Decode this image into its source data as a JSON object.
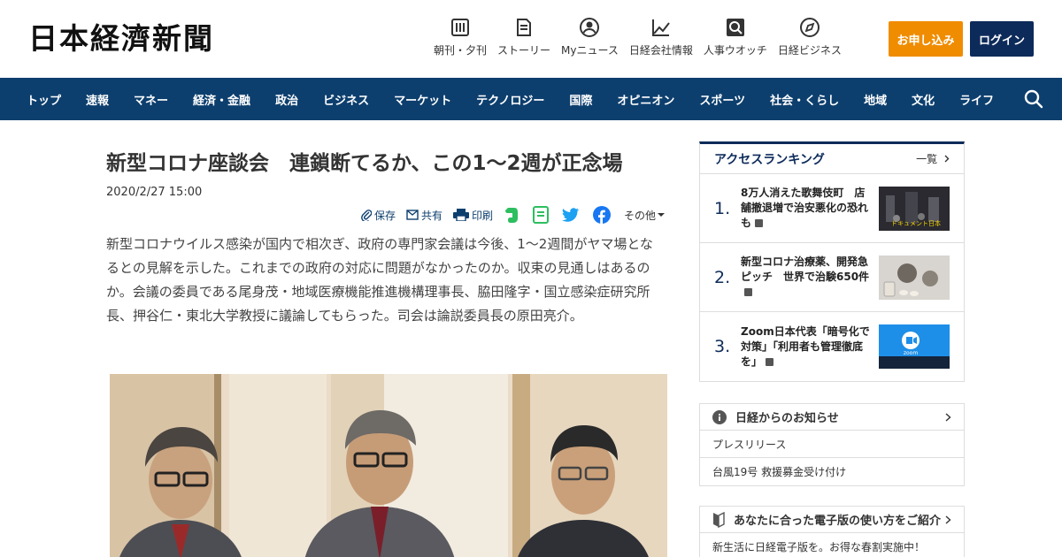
{
  "header": {
    "logo": "日本経濟新聞",
    "nav": [
      {
        "label": "朝刊・夕刊",
        "icon": "newspaper-icon"
      },
      {
        "label": "ストーリー",
        "icon": "document-icon"
      },
      {
        "label": "Myニュース",
        "icon": "user-icon"
      },
      {
        "label": "日経会社情報",
        "icon": "chart-icon"
      },
      {
        "label": "人事ウオッチ",
        "icon": "search-person-icon"
      },
      {
        "label": "日経ビジネス",
        "icon": "compass-icon"
      }
    ],
    "subscribe_label": "お申し込み",
    "login_label": "ログイン"
  },
  "navbar": {
    "items": [
      "トップ",
      "速報",
      "マネー",
      "経済・金融",
      "政治",
      "ビジネス",
      "マーケット",
      "テクノロジー",
      "国際",
      "オピニオン",
      "スポーツ",
      "社会・くらし",
      "地域",
      "文化",
      "ライフ"
    ]
  },
  "article": {
    "title": "新型コロナ座談会　連鎖断てるか、この1～2週が正念場",
    "date": "2020/2/27 15:00",
    "share": {
      "save": "保存",
      "share": "共有",
      "print": "印刷",
      "more": "その他"
    },
    "lead": "新型コロナウイルス感染が国内で相次ぎ、政府の専門家会議は今後、1～2週間がヤマ場となるとの見解を示した。これまでの政府の対応に問題がなかったのか。収束の見通しはあるのか。会議の委員である尾身茂・地域医療機能推進機構理事長、脇田隆字・国立感染症研究所長、押谷仁・東北大学教授に議論してもらった。司会は論説委員長の原田亮介。"
  },
  "ranking": {
    "title": "アクセスランキング",
    "more": "一覧",
    "items": [
      {
        "rank": "1.",
        "text": "8万人消えた歌舞伎町　店舗撤退増で治安悪化の恐れも",
        "thumb_caption": "ドキュメント日本"
      },
      {
        "rank": "2.",
        "text": "新型コロナ治療薬、開発急ピッチ　世界で治験650件"
      },
      {
        "rank": "3.",
        "text": "Zoom日本代表「暗号化で対策」「利用者も管理徹底を」",
        "thumb_caption": "zoom"
      }
    ]
  },
  "notice": {
    "title": "日経からのお知らせ",
    "items": [
      "プレスリリース",
      "台風19号 救援募金受け付け"
    ]
  },
  "guide": {
    "title": "あなたに合った電子版の使い方をご紹介",
    "text": "新生活に日経電子版を。お得な春割実施中！"
  },
  "colors": {
    "navy": "#0d3f6e",
    "dark_navy": "#0d2b5a",
    "orange": "#f08c00"
  }
}
